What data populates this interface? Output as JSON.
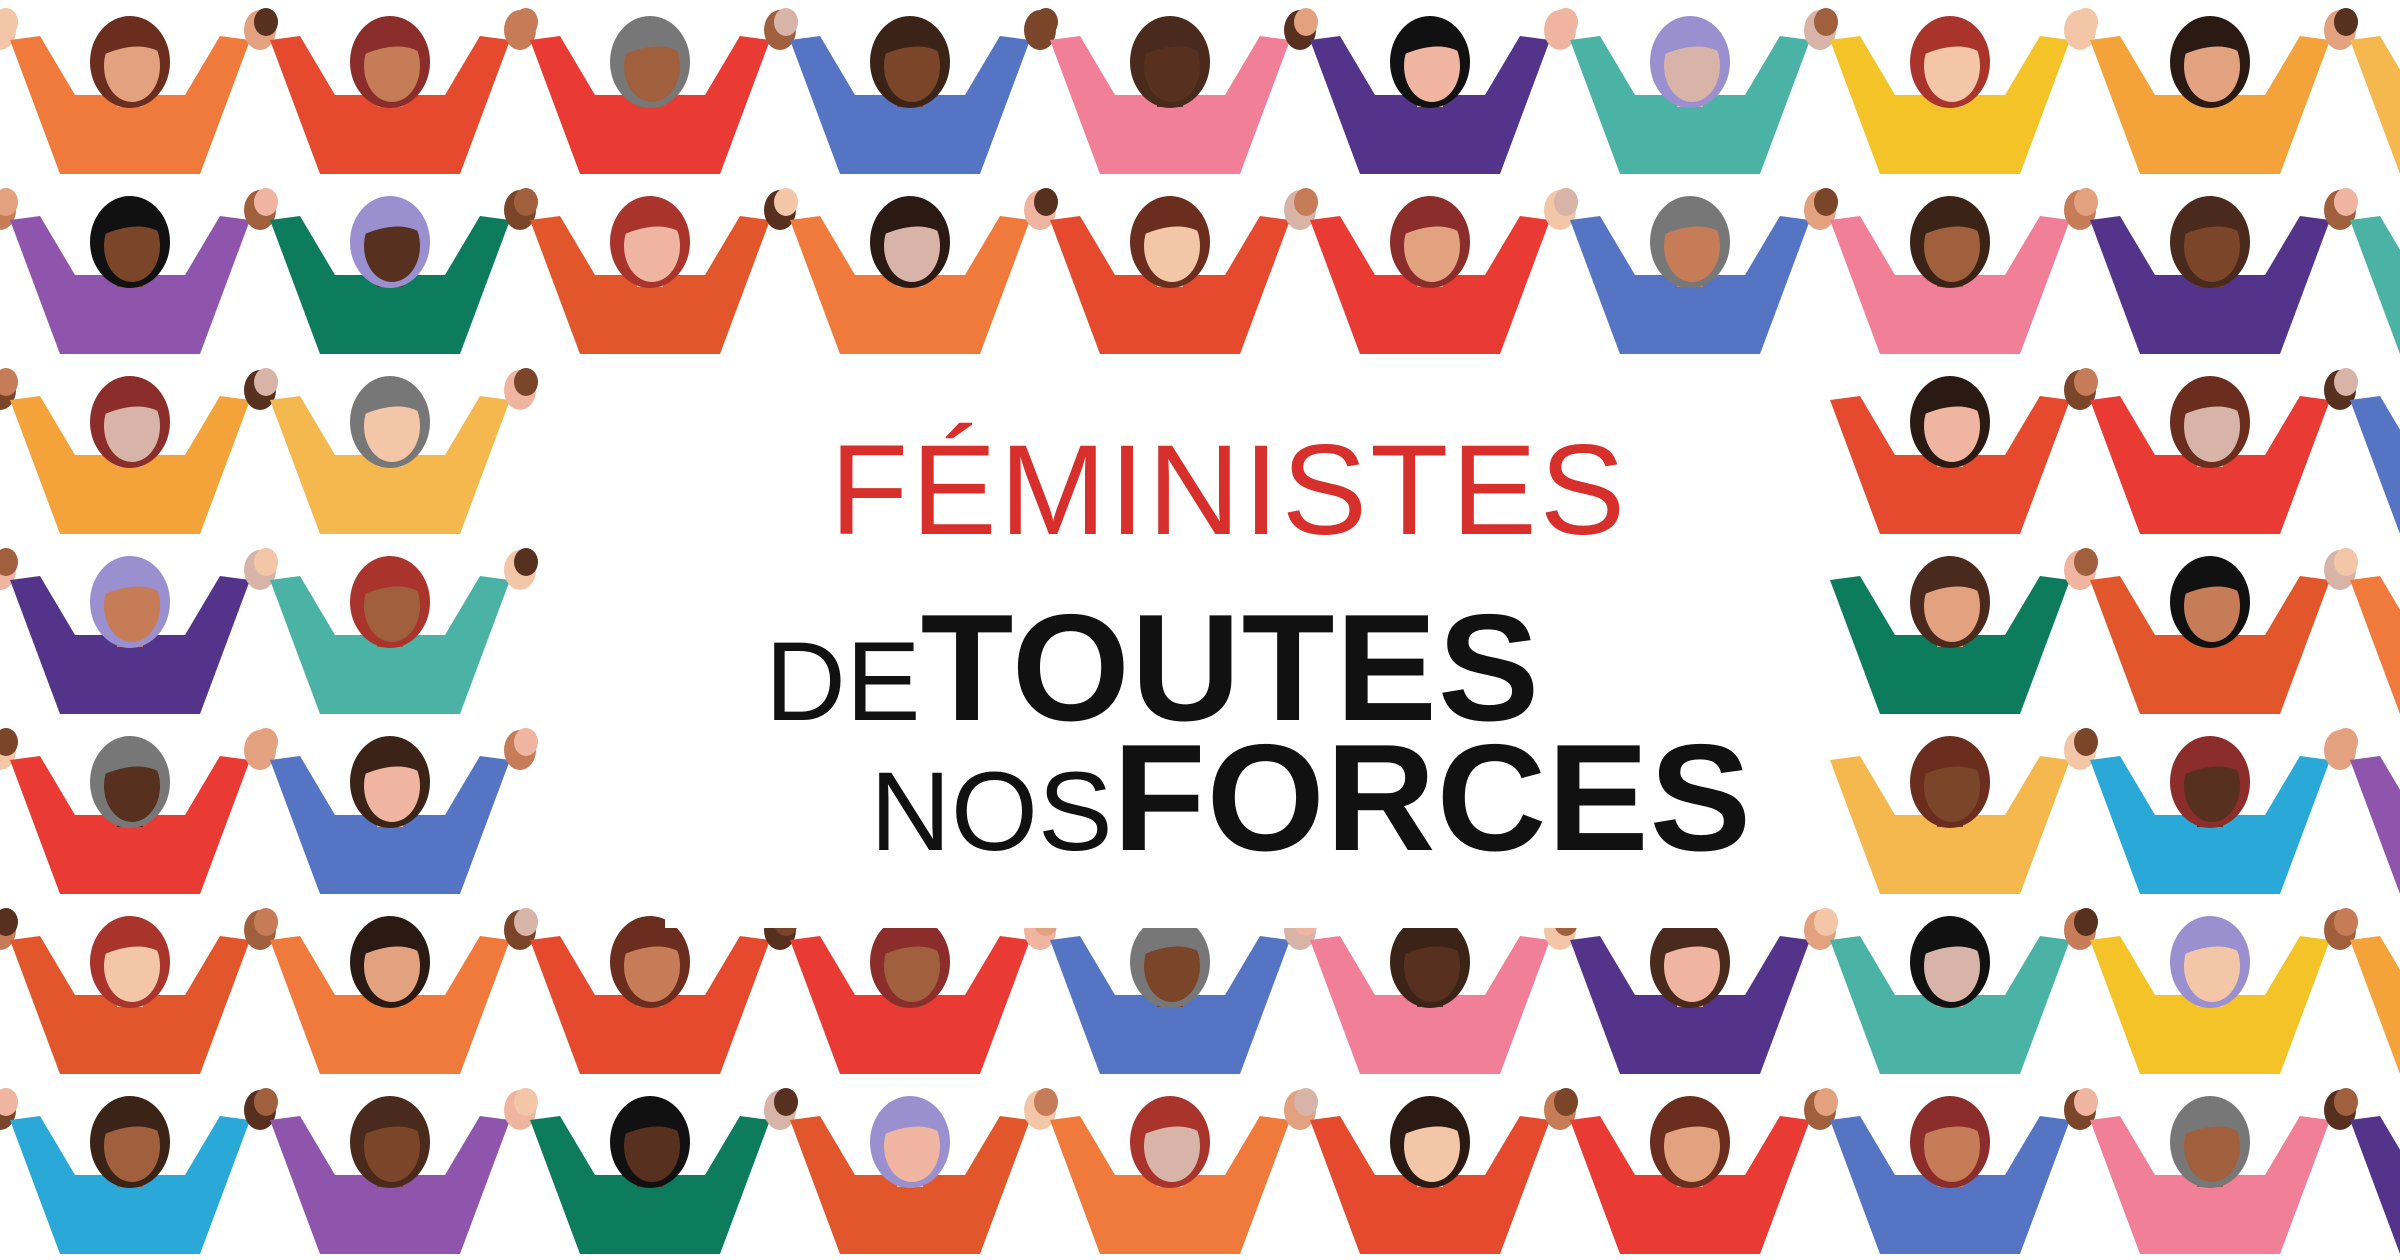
{
  "title": {
    "line1": "FÉMINISTES",
    "line2_small": "DE",
    "line2_big": "TOUTES",
    "line3_small": "NOS",
    "line3_big": "FORCES"
  },
  "colors": {
    "accent": "#d62f2c",
    "text": "#111111",
    "background": "#ffffff",
    "shirts": [
      "#e2562b",
      "#f07f97",
      "#f5b84e",
      "#f07a3c",
      "#54338a",
      "#2aa8d8",
      "#e54a2f",
      "#4bb3a6",
      "#8f55ad",
      "#e93b34",
      "#f3c327",
      "#0d7c5c",
      "#5574c4",
      "#f4a33b"
    ],
    "skin": [
      "#f3c6a7",
      "#e2a27f",
      "#c67c56",
      "#a0603e",
      "#7a4529",
      "#573020",
      "#efb5a0",
      "#d8b3a8"
    ],
    "hair": [
      "#2b1a14",
      "#4a2a1c",
      "#6b2e1e",
      "#111111",
      "#8b2d2a",
      "#9a8fcf",
      "#777777",
      "#a8342c",
      "#3b2417"
    ]
  },
  "figure_icon": "woman-figure-icon",
  "hands_icon": "joined-hands-icon"
}
